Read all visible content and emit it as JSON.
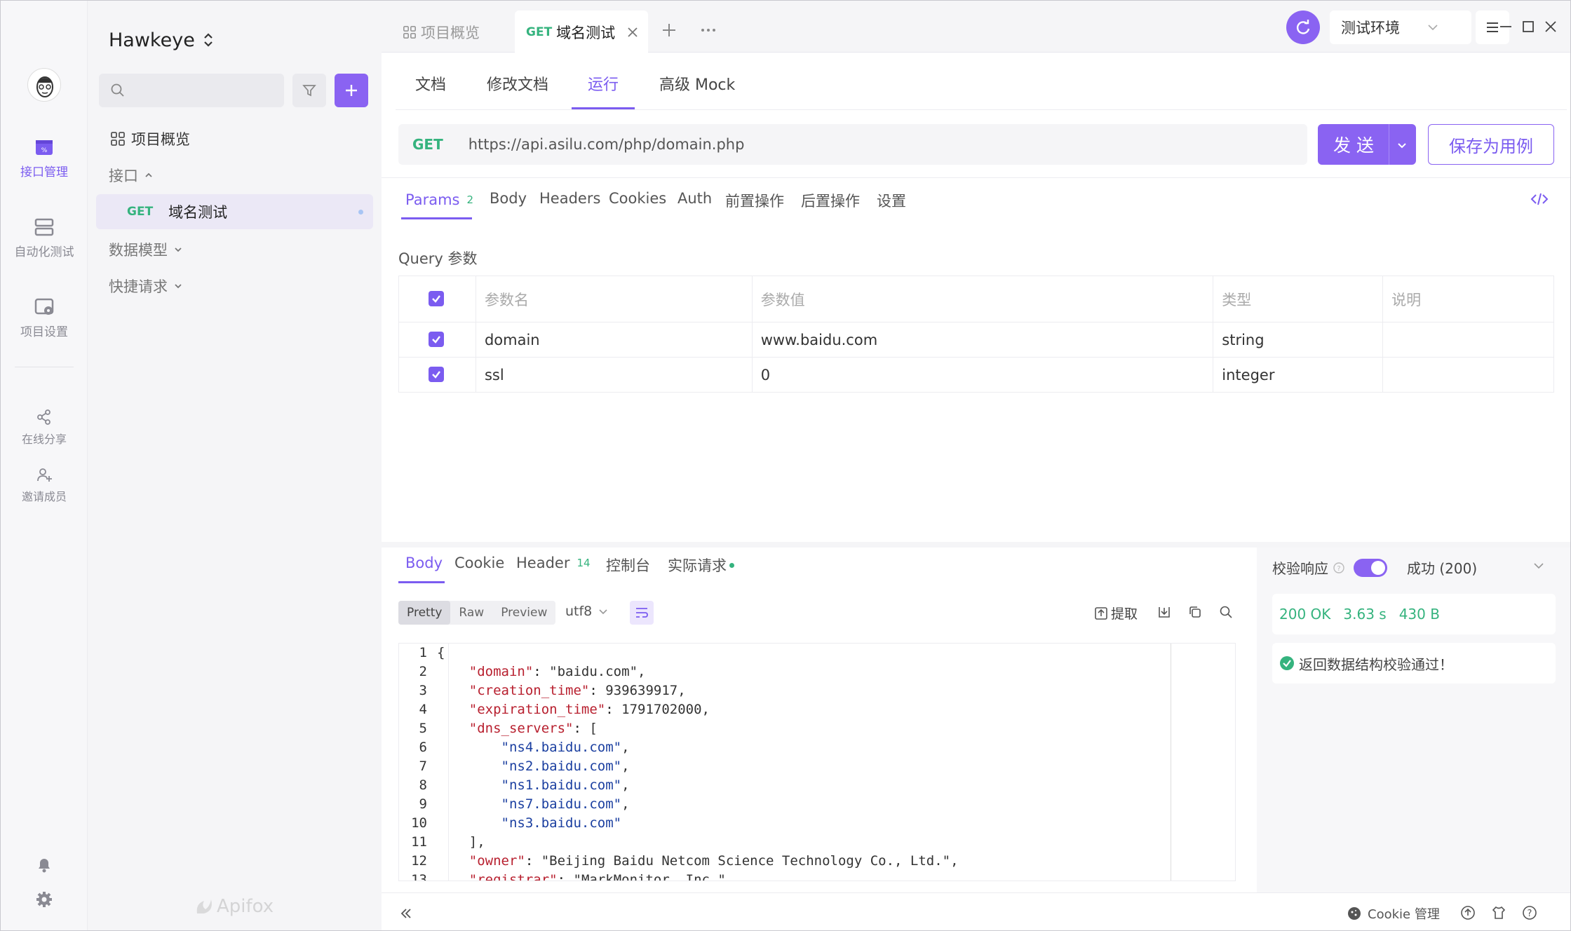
{
  "app": {
    "project_name": "Hawkeye",
    "brand": "Apifox"
  },
  "rail": {
    "items": [
      {
        "label": "接口管理",
        "icon": "api-manage-icon"
      },
      {
        "label": "自动化测试",
        "icon": "automation-icon"
      },
      {
        "label": "项目设置",
        "icon": "project-settings-icon"
      },
      {
        "label": "在线分享",
        "icon": "share-icon"
      },
      {
        "label": "邀请成员",
        "icon": "invite-member-icon"
      }
    ]
  },
  "sidebar": {
    "search_placeholder": "",
    "overview": "项目概览",
    "interfaces_group": "接口",
    "endpoint": {
      "method": "GET",
      "name": "域名测试"
    },
    "data_models": "数据模型",
    "quick_request": "快捷请求"
  },
  "tabs": [
    {
      "label": "项目概览"
    },
    {
      "method": "GET",
      "label": "域名测试"
    }
  ],
  "env": {
    "label": "测试环境"
  },
  "subtabs": [
    "文档",
    "修改文档",
    "运行",
    "高级 Mock"
  ],
  "request": {
    "method": "GET",
    "url": "https://api.asilu.com/php/domain.php",
    "send_label": "发 送",
    "save_label": "保存为用例"
  },
  "param_tabs": {
    "params_label": "Params",
    "params_count": "2",
    "body": "Body",
    "headers": "Headers",
    "cookies": "Cookies",
    "auth": "Auth",
    "pre": "前置操作",
    "post": "后置操作",
    "settings": "设置"
  },
  "query": {
    "title": "Query 参数",
    "headers": [
      "参数名",
      "参数值",
      "类型",
      "说明"
    ],
    "rows": [
      {
        "name": "domain",
        "value": "www.baidu.com",
        "type": "string",
        "desc": ""
      },
      {
        "name": "ssl",
        "value": "0",
        "type": "integer",
        "desc": ""
      }
    ]
  },
  "response": {
    "tabs": {
      "body": "Body",
      "cookie": "Cookie",
      "header": "Header",
      "header_count": "14",
      "console": "控制台",
      "actual": "实际请求"
    },
    "views": [
      "Pretty",
      "Raw",
      "Preview"
    ],
    "encoding": "utf8",
    "extract": "提取",
    "code_lines": [
      "{",
      "    \"domain\": \"baidu.com\",",
      "    \"creation_time\": 939639917,",
      "    \"expiration_time\": 1791702000,",
      "    \"dns_servers\": [",
      "        \"ns4.baidu.com\",",
      "        \"ns2.baidu.com\",",
      "        \"ns1.baidu.com\",",
      "        \"ns7.baidu.com\",",
      "        \"ns3.baidu.com\"",
      "    ],",
      "    \"owner\": \"Beijing Baidu Netcom Science Technology Co., Ltd.\",",
      "    \"registrar\": \"MarkMonitor, Inc.\","
    ]
  },
  "validation": {
    "label": "校验响应",
    "result": "成功 (200)",
    "status": "200 OK",
    "time": "3.63 s",
    "size": "430 B",
    "message": "返回数据结构校验通过！"
  },
  "footer": {
    "cookie_manage": "Cookie 管理"
  },
  "colors": {
    "accent": "#7b5cf0",
    "get": "#35b37e"
  }
}
